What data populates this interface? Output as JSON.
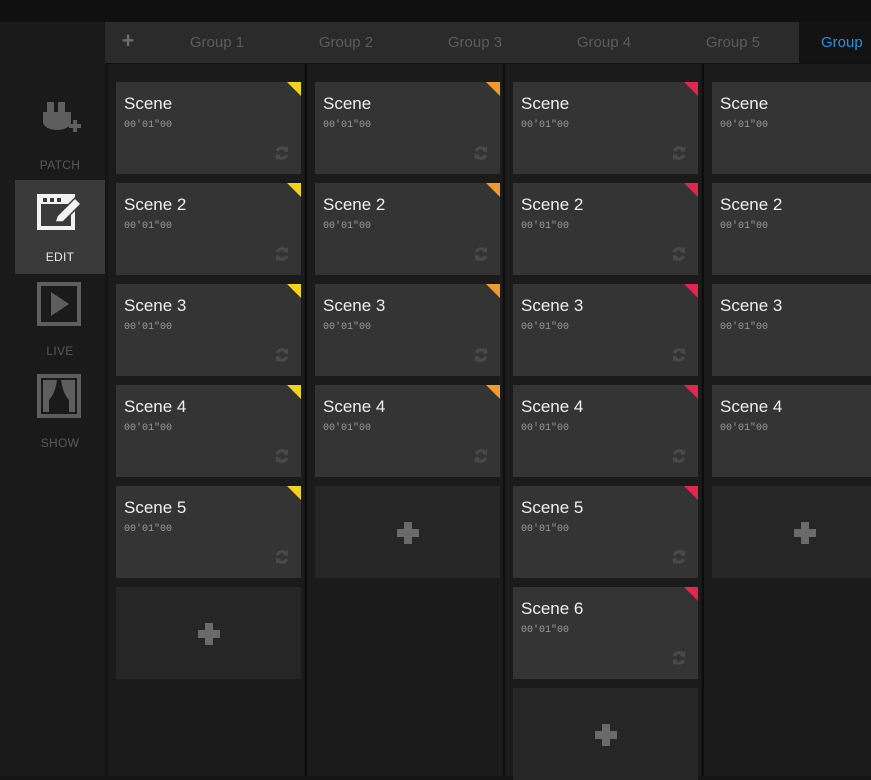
{
  "sidebar": {
    "items": [
      {
        "label": "PATCH",
        "icon": "patch-icon",
        "active": false
      },
      {
        "label": "EDIT",
        "icon": "edit-icon",
        "active": true
      },
      {
        "label": "LIVE",
        "icon": "live-play-icon",
        "active": false
      },
      {
        "label": "SHOW",
        "icon": "show-stage-icon",
        "active": false
      }
    ]
  },
  "tabs": {
    "add_label": "+",
    "items": [
      {
        "label": "Group 1",
        "active": false
      },
      {
        "label": "Group 2",
        "active": false
      },
      {
        "label": "Group 3",
        "active": false
      },
      {
        "label": "Group 4",
        "active": false
      },
      {
        "label": "Group 5",
        "active": false
      },
      {
        "label": "Group",
        "active": true
      }
    ]
  },
  "colors": {
    "tag_yellow": "#f2d21c",
    "tag_orange": "#f29a2e",
    "tag_red": "#e2264f",
    "active_tab_text": "#2f8fdc"
  },
  "columns": [
    {
      "tag_color": "#f2d21c",
      "scenes": [
        {
          "name": "Scene",
          "time": "00'01\"00"
        },
        {
          "name": "Scene 2",
          "time": "00'01\"00"
        },
        {
          "name": "Scene 3",
          "time": "00'01\"00"
        },
        {
          "name": "Scene 4",
          "time": "00'01\"00"
        },
        {
          "name": "Scene 5",
          "time": "00'01\"00"
        }
      ]
    },
    {
      "tag_color": "#f29a2e",
      "scenes": [
        {
          "name": "Scene",
          "time": "00'01\"00"
        },
        {
          "name": "Scene 2",
          "time": "00'01\"00"
        },
        {
          "name": "Scene 3",
          "time": "00'01\"00"
        },
        {
          "name": "Scene 4",
          "time": "00'01\"00"
        }
      ]
    },
    {
      "tag_color": "#e2264f",
      "scenes": [
        {
          "name": "Scene",
          "time": "00'01\"00"
        },
        {
          "name": "Scene 2",
          "time": "00'01\"00"
        },
        {
          "name": "Scene 3",
          "time": "00'01\"00"
        },
        {
          "name": "Scene 4",
          "time": "00'01\"00"
        },
        {
          "name": "Scene 5",
          "time": "00'01\"00"
        },
        {
          "name": "Scene 6",
          "time": "00'01\"00"
        }
      ]
    },
    {
      "tag_color": "#e2264f",
      "scenes": [
        {
          "name": "Scene",
          "time": "00'01\"00"
        },
        {
          "name": "Scene 2",
          "time": "00'01\"00"
        },
        {
          "name": "Scene 3",
          "time": "00'01\"00"
        },
        {
          "name": "Scene 4",
          "time": "00'01\"00"
        }
      ]
    }
  ]
}
